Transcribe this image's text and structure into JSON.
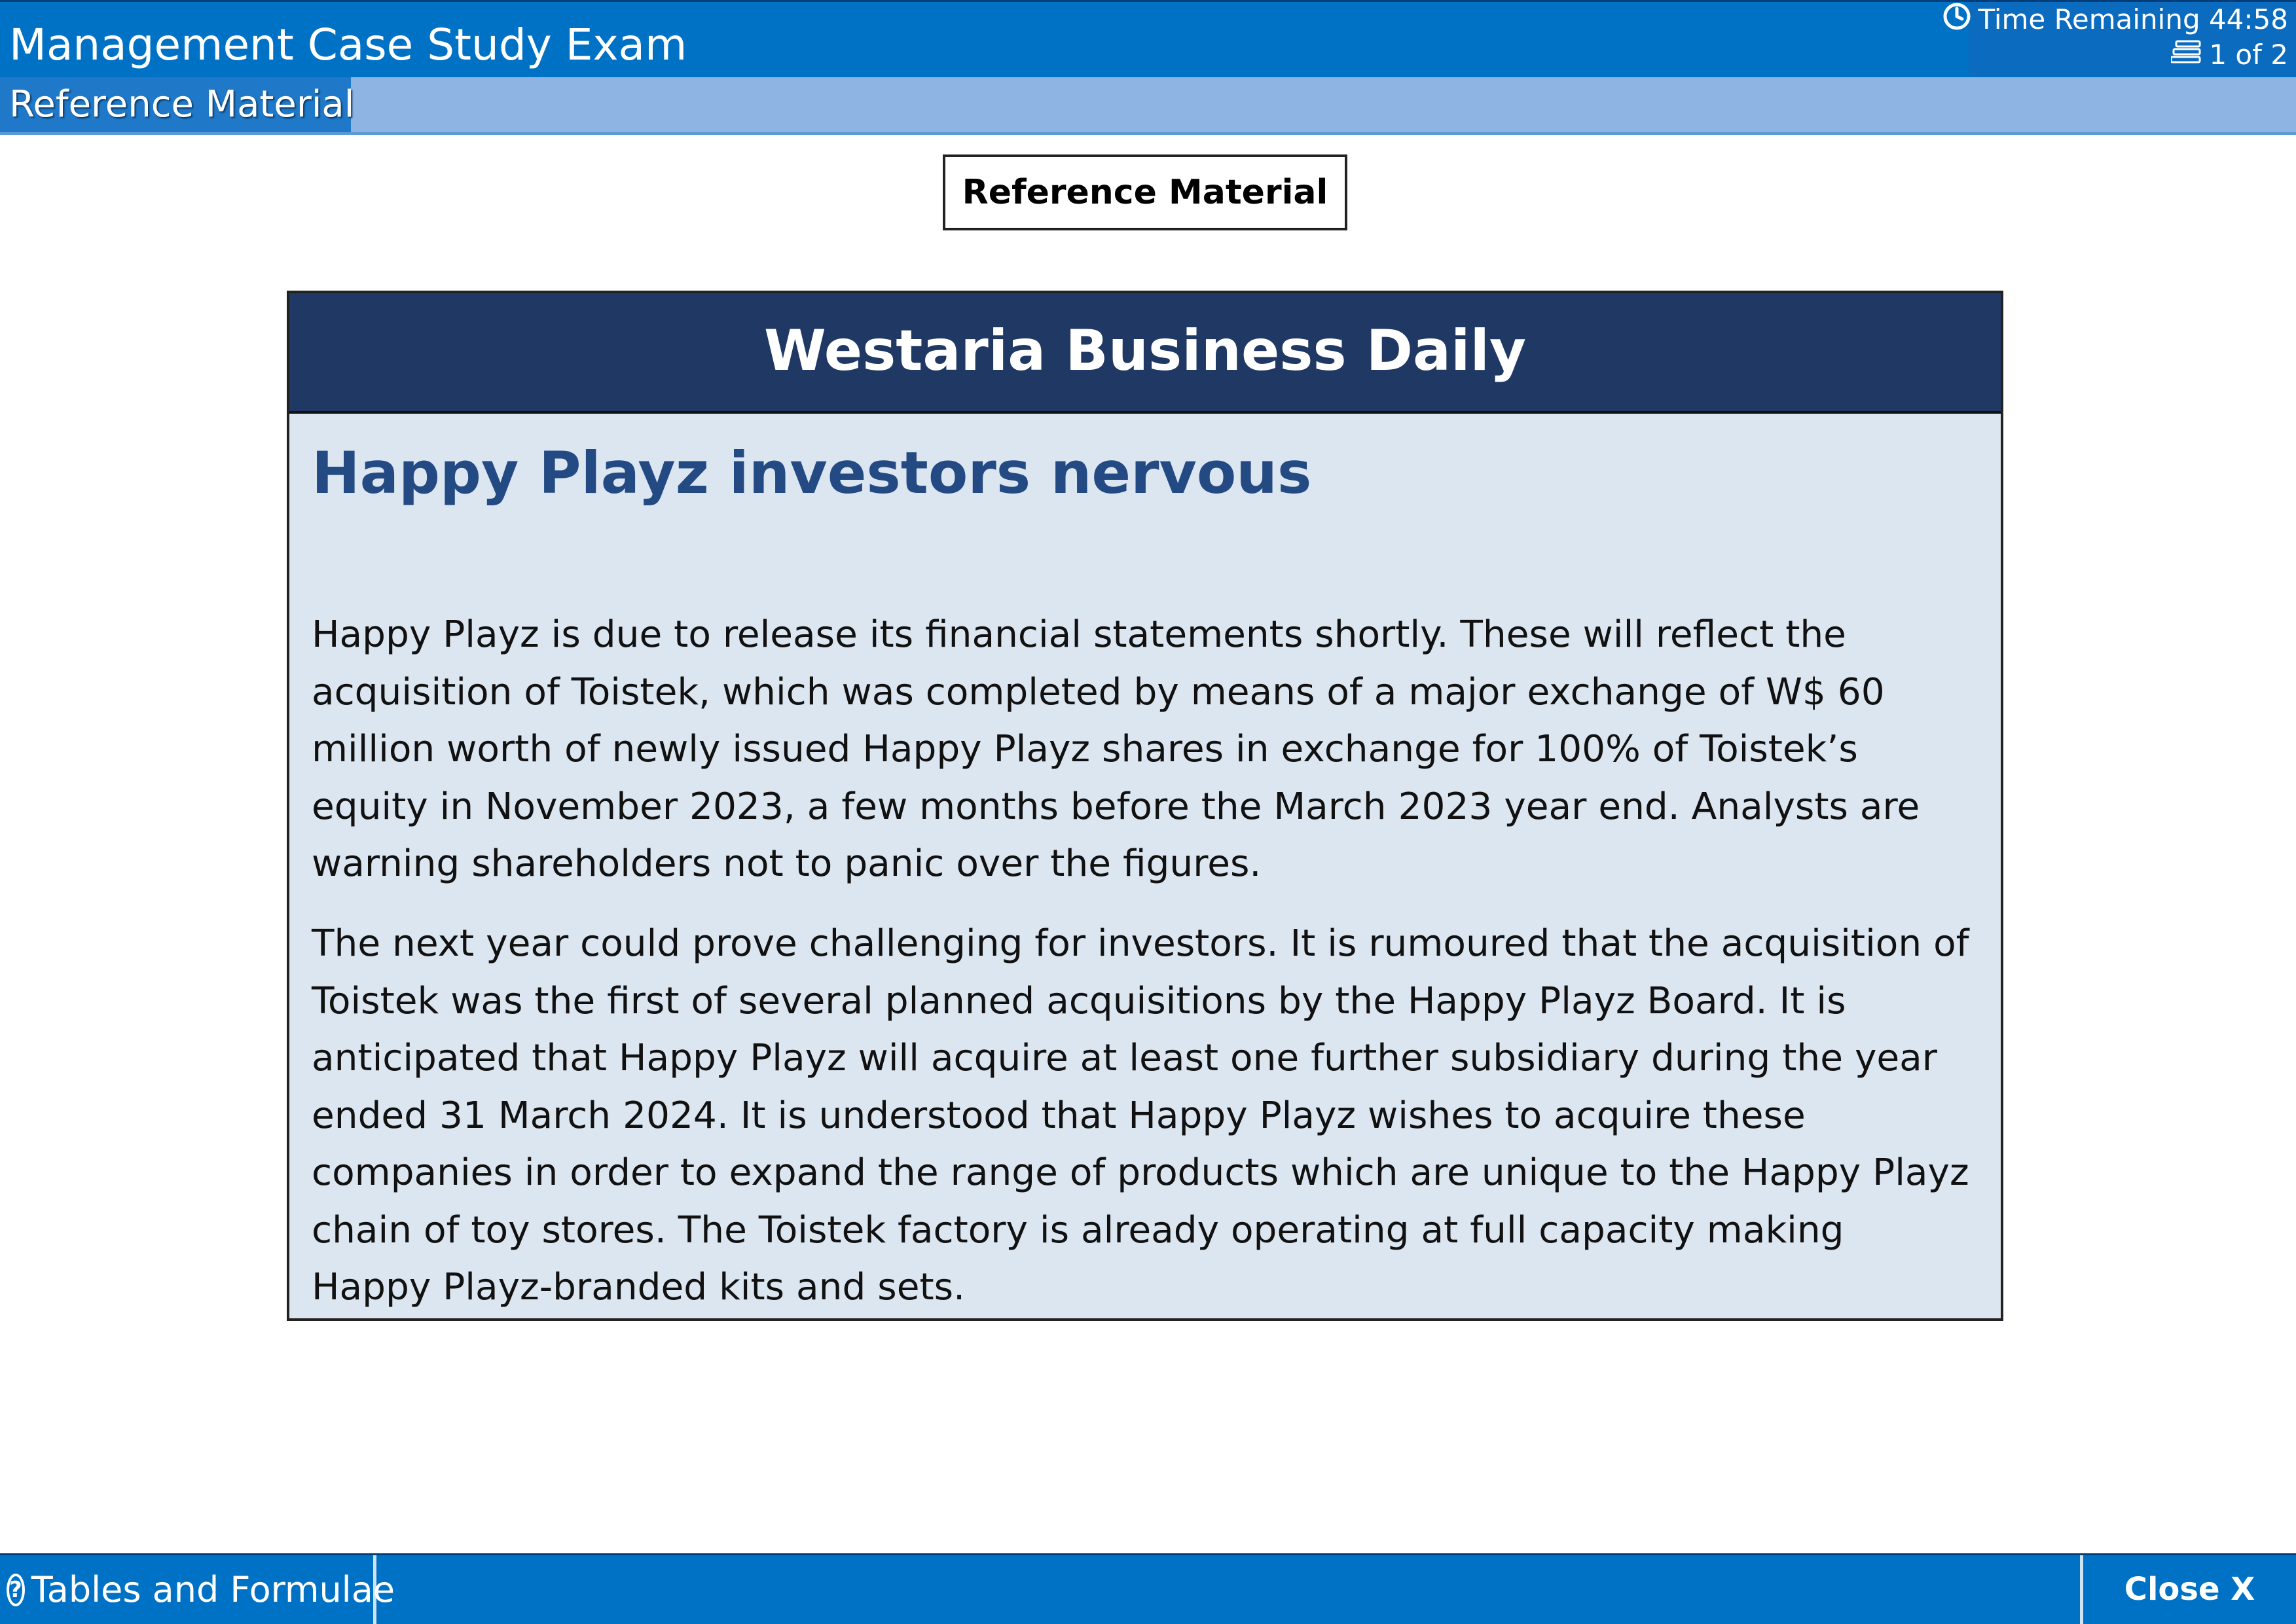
{
  "header": {
    "title": "Management Case Study Exam",
    "timer_label": "Time Remaining 44:58",
    "page_indicator": "1 of 2"
  },
  "subheader": {
    "tab_label": "Reference Material"
  },
  "content": {
    "section_label": "Reference Material",
    "article": {
      "publication": "Westaria Business Daily",
      "headline": "Happy Playz investors nervous",
      "paragraphs": [
        "Happy Playz is due to release its financial statements shortly. These will reflect the acquisition of Toistek, which was completed by means of a major exchange of W$ 60 million worth of newly issued Happy Playz shares in exchange for 100% of Toistek’s equity in November 2023, a few months before the March 2023 year end. Analysts are warning shareholders not to panic over the figures.",
        "The next year could prove challenging for investors. It is rumoured that the acquisition of Toistek was the first of several planned acquisitions by the Happy Playz Board. It is anticipated that Happy Playz will acquire at least one further subsidiary during the year ended 31 March 2024. It is understood that Happy Playz wishes to acquire these companies in order to expand the range of products which are unique to the Happy Playz chain of toy stores. The Toistek factory is already operating at full capacity making Happy Playz-branded kits and sets."
      ]
    }
  },
  "footer": {
    "tables_label": "Tables and Formulae",
    "close_label": "Close X"
  },
  "icons": {
    "timer": "clock-icon",
    "pages": "page-stack-icon",
    "help": "help-icon"
  },
  "colors": {
    "header_blue": "#0072c6",
    "subheader_blue": "#8db4e2",
    "masthead_navy": "#1f3864",
    "article_background": "#dce6f1",
    "headline_blue": "#244a84"
  }
}
